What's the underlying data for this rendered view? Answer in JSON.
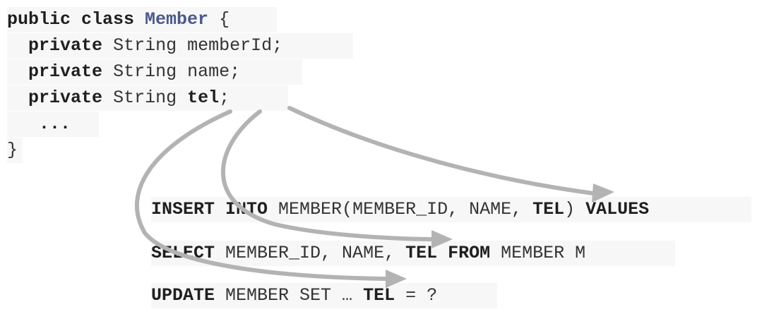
{
  "java_class": {
    "decl_kw": "public class",
    "name": "Member",
    "open_brace": "{",
    "fields": [
      {
        "modifier": "private",
        "type": "String",
        "name": "memberId",
        "semicolon": ";"
      },
      {
        "modifier": "private",
        "type": "String",
        "name": "name",
        "semicolon": ";"
      },
      {
        "modifier": "private",
        "type": "String",
        "name": "tel",
        "semicolon": ";"
      }
    ],
    "ellipsis": "...",
    "close_brace": "}"
  },
  "sql": {
    "insert": {
      "kw1": "INSERT INTO",
      "table_open": "MEMBER(MEMBER_ID, NAME,",
      "tel": "TEL",
      "close": ")",
      "kw2": "VALUES"
    },
    "select": {
      "kw1": "SELECT",
      "cols": "MEMBER_ID, NAME,",
      "tel": "TEL",
      "kw2": "FROM",
      "table": "MEMBER M"
    },
    "update": {
      "kw1": "UPDATE",
      "mid": "MEMBER SET …",
      "tel": "TEL",
      "tail": "= ?"
    }
  },
  "colors": {
    "arrow": "#b3b3b3",
    "code_bg": "#f7f7f7",
    "class_name": "#4a5a8c"
  }
}
